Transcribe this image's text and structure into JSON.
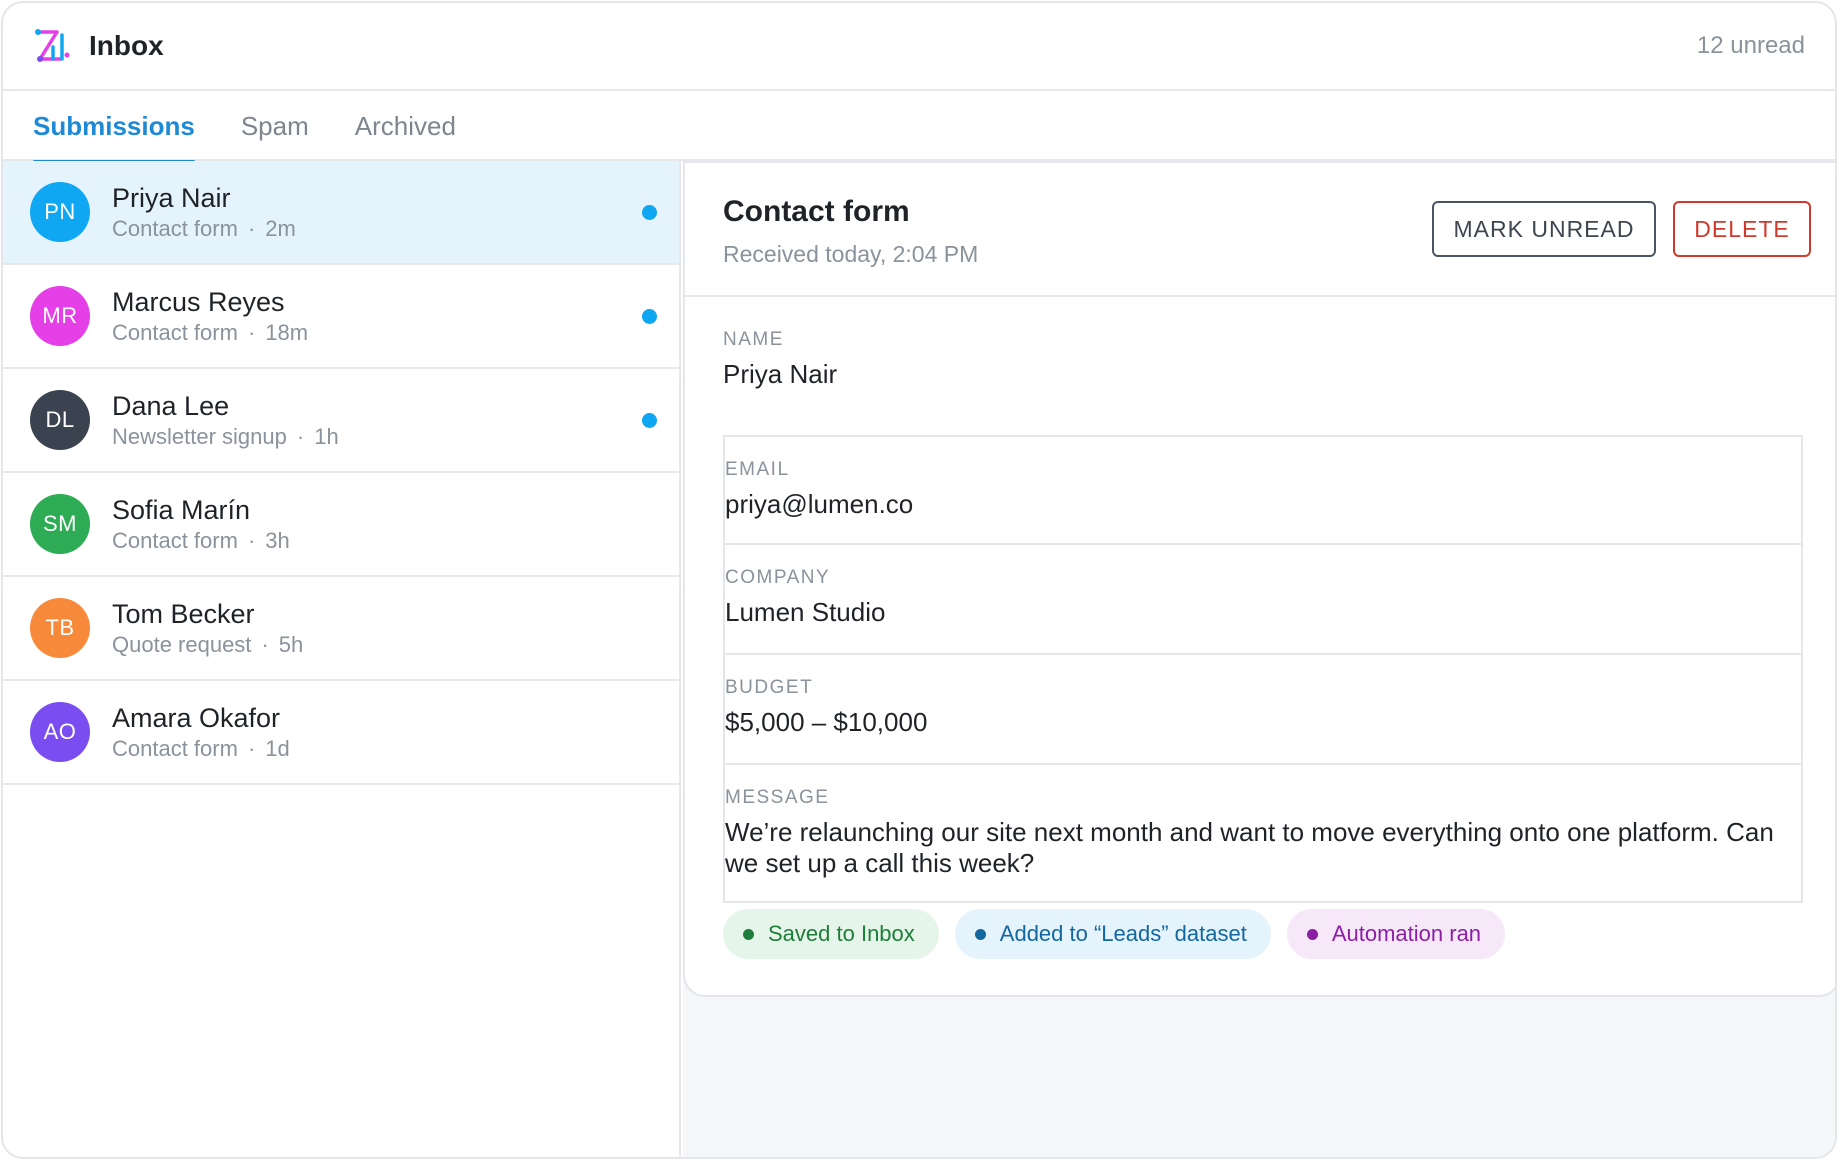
{
  "header": {
    "logo_icon": "brand-logo-icon",
    "title": "Inbox",
    "unread_label": "12 unread"
  },
  "tabs": [
    {
      "label": "Submissions",
      "active": true
    },
    {
      "label": "Spam",
      "active": false
    },
    {
      "label": "Archived",
      "active": false
    }
  ],
  "submissions": [
    {
      "initials": "PN",
      "name": "Priya Nair",
      "form": "Contact form",
      "age": "2m",
      "unread": true,
      "selected": true,
      "color": "#10a7f2"
    },
    {
      "initials": "MR",
      "name": "Marcus Reyes",
      "form": "Contact form",
      "age": "18m",
      "unread": true,
      "selected": false,
      "color": "#e540e8"
    },
    {
      "initials": "DL",
      "name": "Dana Lee",
      "form": "Newsletter signup",
      "age": "1h",
      "unread": true,
      "selected": false,
      "color": "#3b4350"
    },
    {
      "initials": "SM",
      "name": "Sofia Marín",
      "form": "Contact form",
      "age": "3h",
      "unread": false,
      "selected": false,
      "color": "#2eac55"
    },
    {
      "initials": "TB",
      "name": "Tom Becker",
      "form": "Quote request",
      "age": "5h",
      "unread": false,
      "selected": false,
      "color": "#f7893a"
    },
    {
      "initials": "AO",
      "name": "Amara Okafor",
      "form": "Contact form",
      "age": "1d",
      "unread": false,
      "selected": false,
      "color": "#7a4df0"
    }
  ],
  "detail": {
    "title": "Contact form",
    "received": "Received today, 2:04 PM",
    "mark_unread_label": "MARK UNREAD",
    "delete_label": "DELETE",
    "fields": {
      "name": {
        "label": "NAME",
        "value": "Priya Nair"
      },
      "email": {
        "label": "EMAIL",
        "value": "priya@lumen.co"
      },
      "company": {
        "label": "COMPANY",
        "value": "Lumen Studio"
      },
      "budget": {
        "label": "BUDGET",
        "value": "$5,000 – $10,000"
      },
      "message": {
        "label": "MESSAGE",
        "value": "We’re relaunching our site next month and want to move everything onto one platform. Can we set up a call this week?"
      }
    },
    "tags": [
      {
        "label": "Saved to Inbox",
        "tone": "green"
      },
      {
        "label": "Added to “Leads” dataset",
        "tone": "blue"
      },
      {
        "label": "Automation ran",
        "tone": "purple"
      }
    ]
  },
  "colors": {
    "accent": "#1e8ad6",
    "unread_dot": "#10a7f2",
    "delete": "#cf3a2c",
    "selected_row": "#e5f3fc"
  }
}
